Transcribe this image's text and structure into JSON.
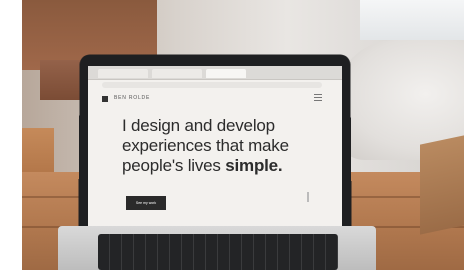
{
  "photo": {
    "alt_subject": "laptop-on-wooden-table"
  },
  "website": {
    "brand": "BEN ROLDE",
    "headline_line1": "I design and develop",
    "headline_line2": "experiences that make",
    "headline_line3_regular": "people's lives ",
    "headline_line3_bold": "simple.",
    "cta_label": "See my work"
  },
  "colors": {
    "table": "#b37a50",
    "screen_bg": "#f3f1ee",
    "text": "#2c2c2c"
  }
}
